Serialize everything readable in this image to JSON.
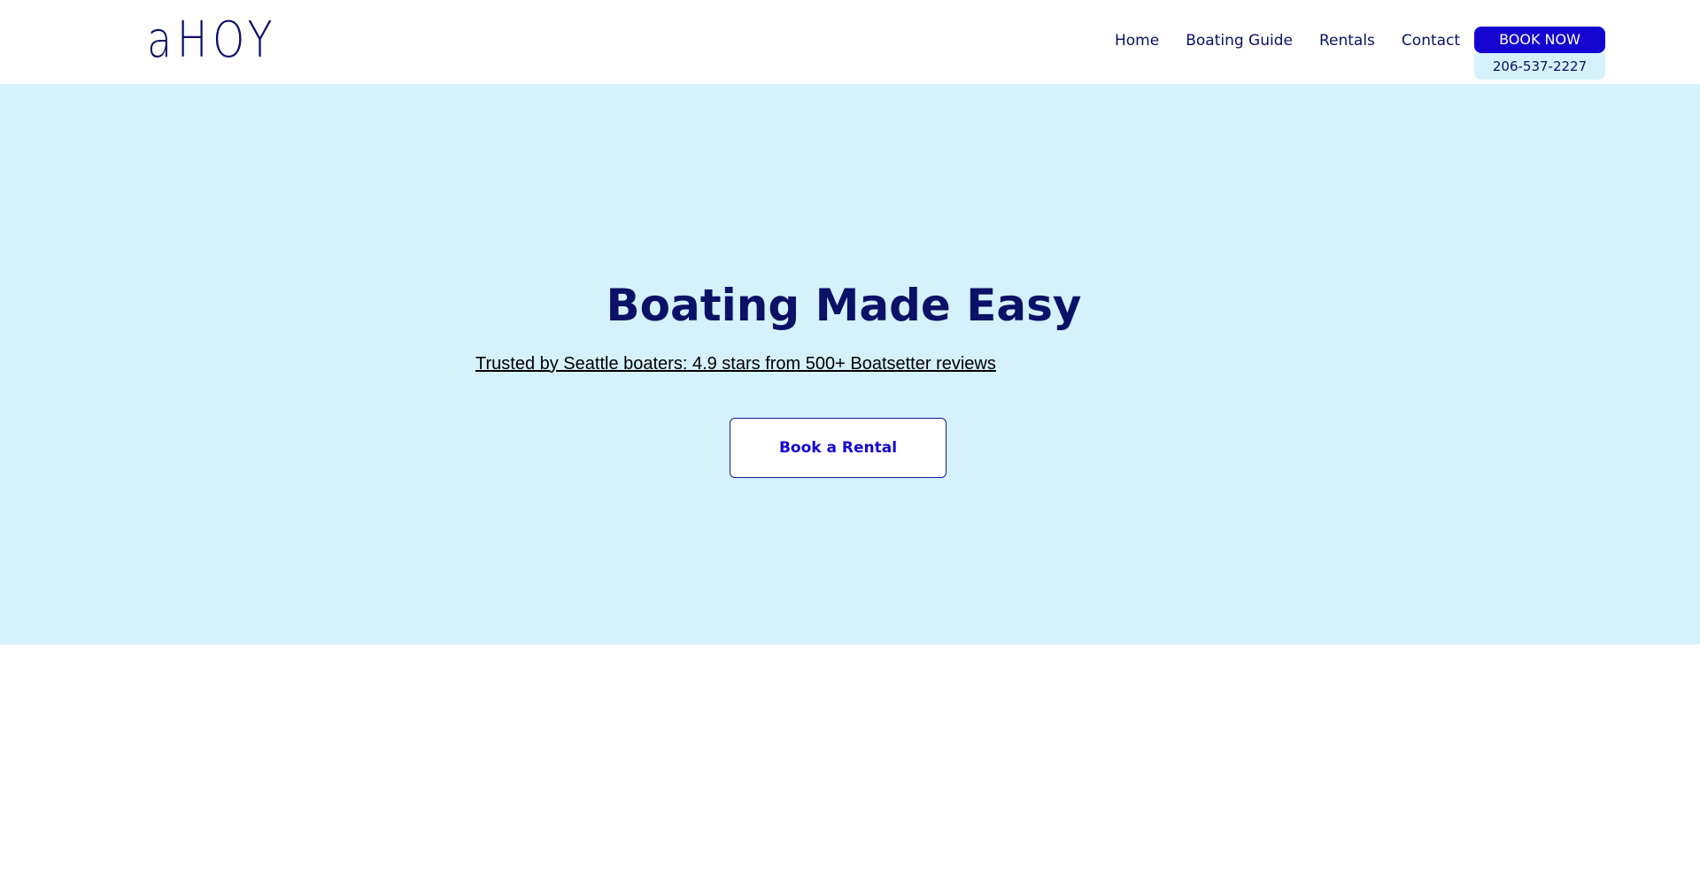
{
  "header": {
    "logo_text": "aHOY",
    "nav": [
      {
        "label": "Home"
      },
      {
        "label": "Boating Guide"
      },
      {
        "label": "Rentals"
      },
      {
        "label": "Contact"
      }
    ],
    "book_now_label": "BOOK NOW",
    "phone_label": "206-537-2227"
  },
  "hero": {
    "title": "Boating Made Easy",
    "subtitle": "Trusted by Seattle boaters: 4.9 stars from 500+ Boatsetter reviews",
    "cta_label": "Book a Rental"
  },
  "colors": {
    "brand_navy": "#0a1166",
    "accent_blue": "#1505d0",
    "hero_background": "#d5f1fb"
  }
}
